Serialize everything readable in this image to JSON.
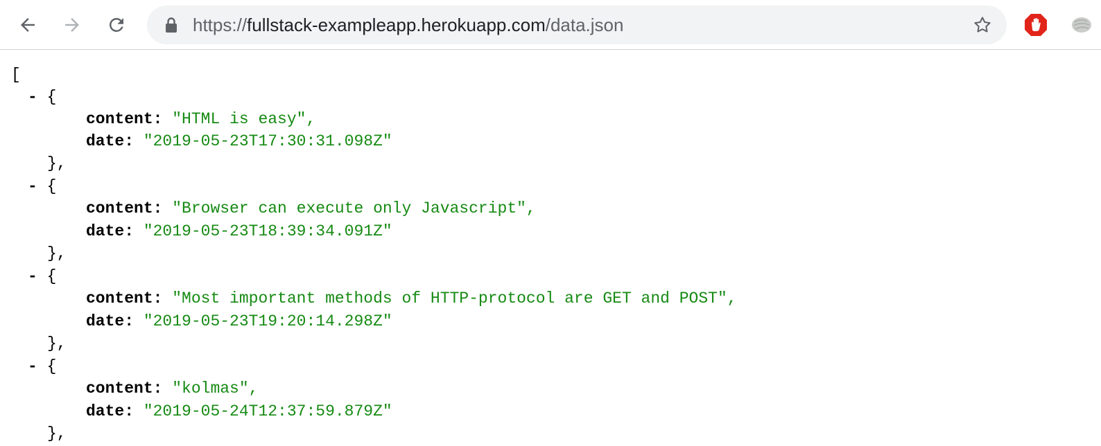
{
  "browser": {
    "url_scheme": "https://",
    "url_host": "fullstack-exampleapp.herokuapp.com",
    "url_path": "/data.json",
    "back_icon": "arrow-left-icon",
    "forward_icon": "arrow-right-icon",
    "reload_icon": "reload-icon",
    "lock_icon": "lock-icon",
    "star_icon": "star-icon",
    "adblock_icon": "adblock-hand-icon"
  },
  "json_view": {
    "open_bracket": "[",
    "collapse_marker": "-",
    "open_brace": "{",
    "close_brace": "},",
    "key_content": "content:",
    "key_date": "date:",
    "items": [
      {
        "content": "\"HTML is easy\",",
        "date": "\"2019-05-23T17:30:31.098Z\""
      },
      {
        "content": "\"Browser can execute only Javascript\",",
        "date": "\"2019-05-23T18:39:34.091Z\""
      },
      {
        "content": "\"Most important methods of HTTP-protocol are GET and POST\",",
        "date": "\"2019-05-23T19:20:14.298Z\""
      },
      {
        "content": "\"kolmas\",",
        "date": "\"2019-05-24T12:37:59.879Z\""
      }
    ]
  },
  "colors": {
    "string": "#168a13",
    "key": "#000000",
    "omnibox_bg": "#f1f3f4",
    "adblock_red": "#e1251b"
  }
}
